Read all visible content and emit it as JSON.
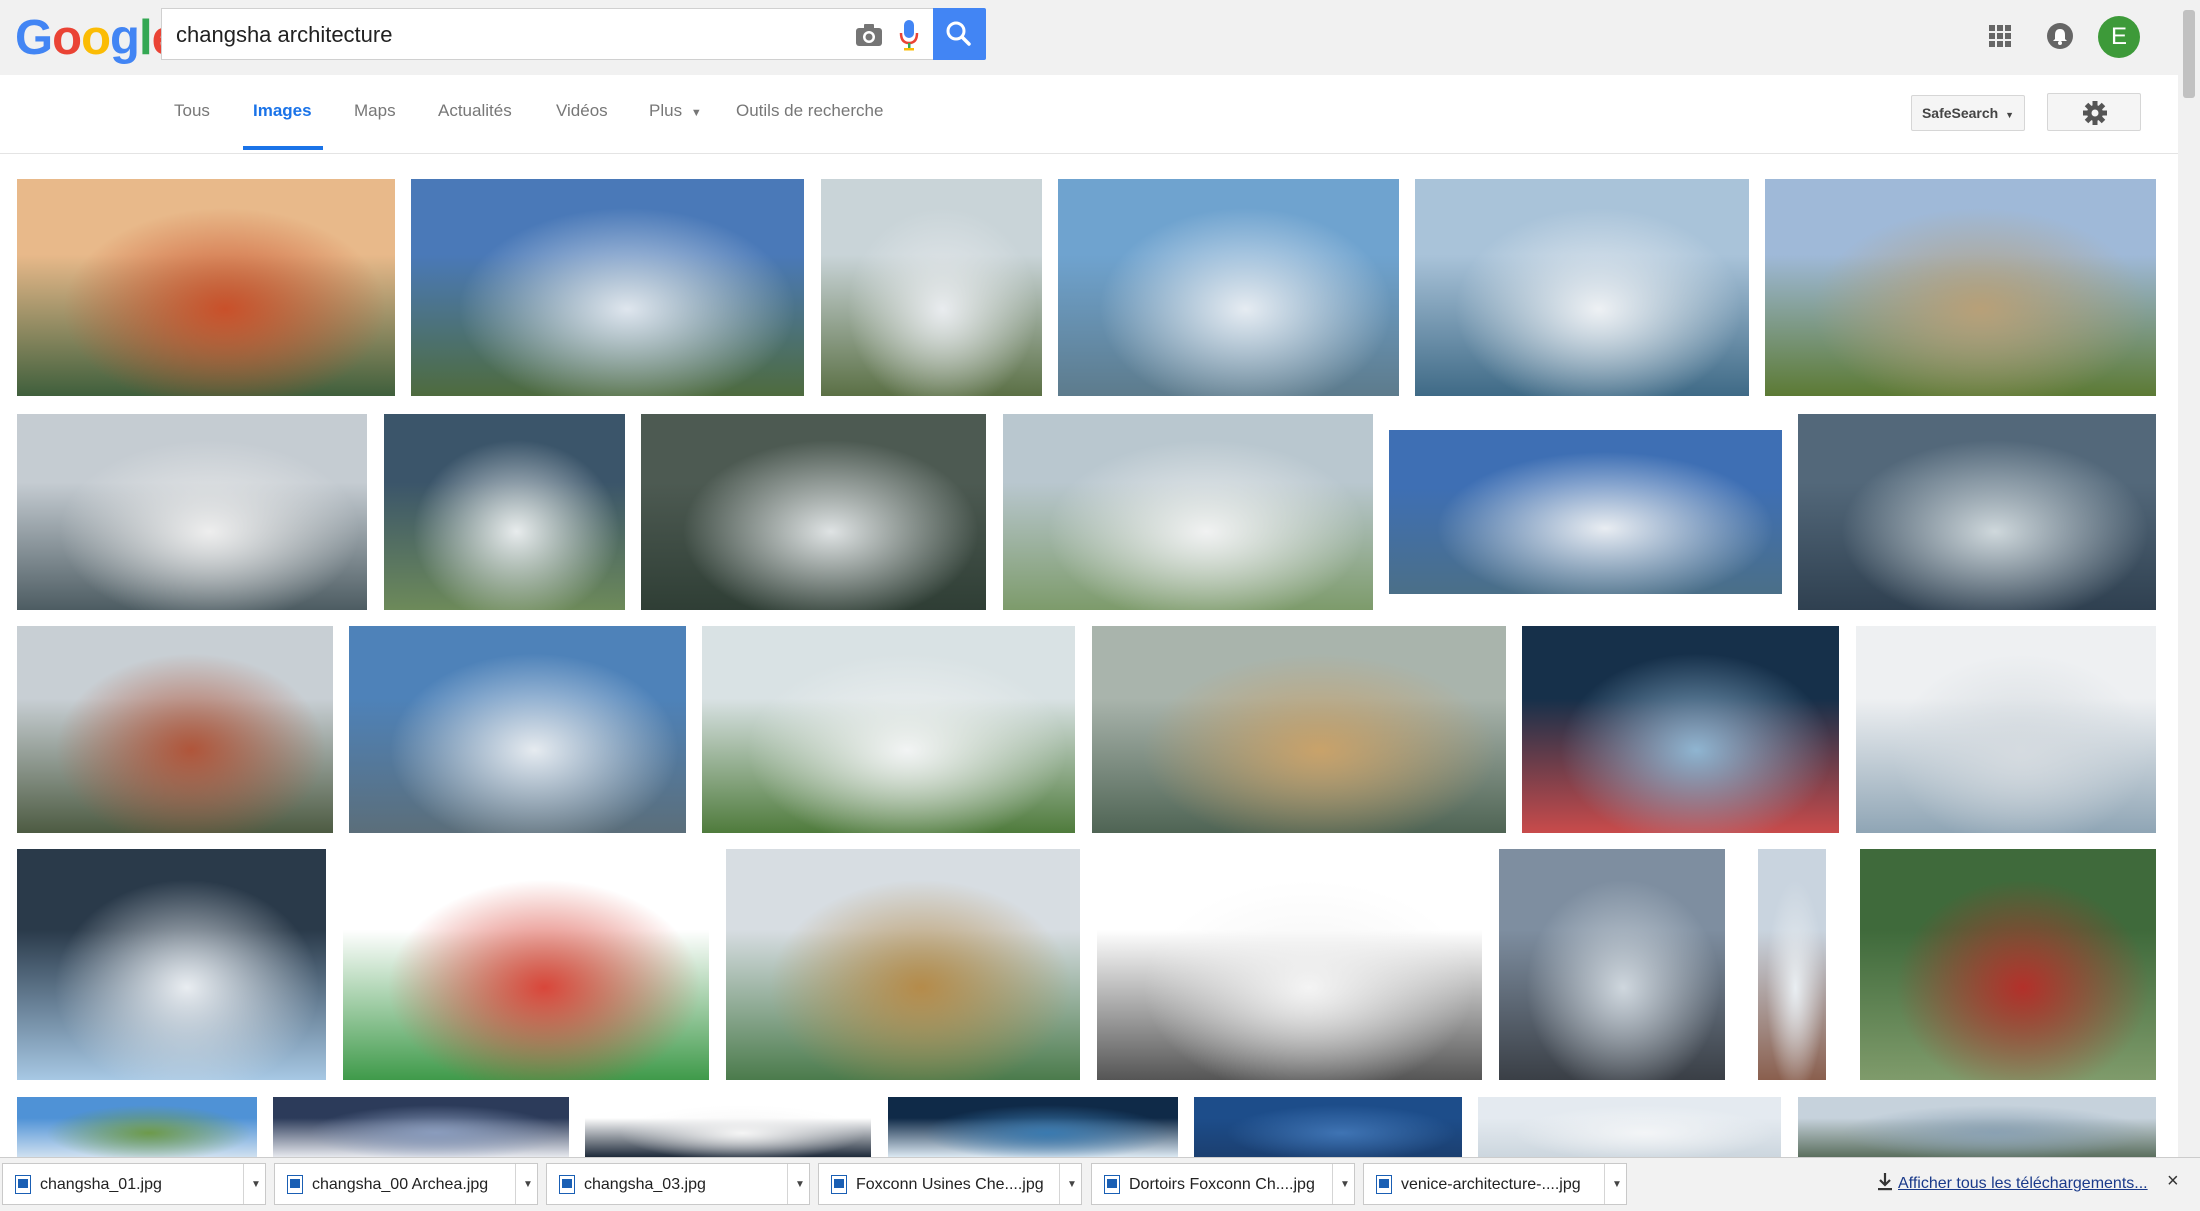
{
  "logo": {
    "text": "Google"
  },
  "search": {
    "value": "changsha architecture"
  },
  "avatar_letter": "E",
  "tabs": [
    {
      "label": "Tous"
    },
    {
      "label": "Images"
    },
    {
      "label": "Maps"
    },
    {
      "label": "Actualités"
    },
    {
      "label": "Vidéos"
    },
    {
      "label": "Plus"
    },
    {
      "label": "Outils de recherche"
    }
  ],
  "active_tab": "Images",
  "safesearch_label": "SafeSearch",
  "colors": {
    "accent": "#1a73e8",
    "search_button": "#4285f4",
    "avatar": "#3d9a39"
  },
  "images": [
    {
      "name": "orange-ribbon-bridge-render",
      "colors": [
        "#e8b98a",
        "#c9502a",
        "#3f5f3c"
      ]
    },
    {
      "name": "white-curved-building-landscape",
      "colors": [
        "#4a79b8",
        "#dfe6ee",
        "#4e6b3e"
      ]
    },
    {
      "name": "flower-shaped-complex-aerial",
      "colors": [
        "#c9d4d8",
        "#e9ecef",
        "#5b7045"
      ]
    },
    {
      "name": "waterfront-opera-house-render",
      "colors": [
        "#6fa3cf",
        "#e6ecf2",
        "#5d7b8c"
      ]
    },
    {
      "name": "city-riverside-complex-aerial",
      "colors": [
        "#a9c3d9",
        "#eef1f4",
        "#3f6a86"
      ]
    },
    {
      "name": "couple-beside-stone-statue",
      "colors": [
        "#9fb9d8",
        "#b8a078",
        "#5c7a34"
      ]
    },
    {
      "name": "complex-with-reflecting-pools",
      "colors": [
        "#c5ccd2",
        "#eeeeee",
        "#4d5c62"
      ]
    },
    {
      "name": "flower-roof-plan-view",
      "colors": [
        "#3b556a",
        "#e8eced",
        "#6d8a5a"
      ]
    },
    {
      "name": "flower-complex-night-aerial",
      "colors": [
        "#4d5a52",
        "#dfe3e4",
        "#2f3e35"
      ]
    },
    {
      "name": "cultural-center-birdseye",
      "colors": [
        "#b9c7cf",
        "#f1f2f2",
        "#7d9b6b"
      ]
    },
    {
      "name": "waterfront-crowd-render",
      "colors": [
        "#3e6fb4",
        "#e9edf2",
        "#4b6f88"
      ]
    },
    {
      "name": "glass-atrium-interior",
      "colors": [
        "#53687a",
        "#cfd8dc",
        "#2f4050"
      ]
    },
    {
      "name": "tower-with-red-soil-site",
      "colors": [
        "#c8cfd4",
        "#b0553a",
        "#4d5b42"
      ]
    },
    {
      "name": "opera-house-dusk-render",
      "colors": [
        "#4e82b9",
        "#e6ebf0",
        "#5b6e7a"
      ]
    },
    {
      "name": "crystal-building-in-park",
      "colors": [
        "#d9e2e4",
        "#f2f4f4",
        "#4f7b3c"
      ]
    },
    {
      "name": "golden-roof-masterplan",
      "colors": [
        "#a9b4ac",
        "#c9a26a",
        "#4f6454"
      ]
    },
    {
      "name": "crystal-facade-night",
      "colors": [
        "#16304a",
        "#8fb5d1",
        "#c94b4b"
      ]
    },
    {
      "name": "curved-white-interior",
      "colors": [
        "#eef0f2",
        "#d5dbe0",
        "#8fa5b5"
      ]
    },
    {
      "name": "curved-hall-people",
      "colors": [
        "#2a3a4a",
        "#e9edf1",
        "#a7c8e4"
      ]
    },
    {
      "name": "ribbon-bridge-sketches",
      "colors": [
        "#ffffff",
        "#d9463a",
        "#3f9a4a"
      ]
    },
    {
      "name": "skyscraper-cluster-render",
      "colors": [
        "#d7dde2",
        "#b58b4a",
        "#4b7b4c"
      ]
    },
    {
      "name": "floor-plan-drawing",
      "colors": [
        "#ffffff",
        "#f4f4f4",
        "#555555"
      ]
    },
    {
      "name": "deconstructed-facade-dusk",
      "colors": [
        "#7e8ea0",
        "#cfd7de",
        "#3a3f46"
      ]
    },
    {
      "name": "small-aerial-collage",
      "colors": [
        "#c9d4df",
        "#e9eef2",
        "#8a5f4e"
      ]
    },
    {
      "name": "red-pavilion-in-trees",
      "colors": [
        "#3f6a3b",
        "#b3302a",
        "#7f9b6b"
      ]
    },
    {
      "name": "treeline-blue-sky",
      "colors": [
        "#4f92d6",
        "#6d9a4a",
        "#cfe0f0"
      ]
    },
    {
      "name": "dome-interior-dark",
      "colors": [
        "#2c3b5a",
        "#8a9cbd",
        "#e6e8ee"
      ]
    },
    {
      "name": "document-chart",
      "colors": [
        "#ffffff",
        "#f5f5f5",
        "#1e2a3a"
      ]
    },
    {
      "name": "night-city-lights",
      "colors": [
        "#0f2a48",
        "#3a7ab0",
        "#dbe8f2"
      ]
    },
    {
      "name": "deep-blue-sky",
      "colors": [
        "#1d4d8a",
        "#3f74b4",
        "#1b3f70"
      ]
    },
    {
      "name": "pale-winter-scene",
      "colors": [
        "#e4eaf0",
        "#f3f5f7",
        "#ccd6de"
      ]
    },
    {
      "name": "city-lake-aerial",
      "colors": [
        "#c6d2dc",
        "#8aa1b3",
        "#5b6f5e"
      ]
    }
  ],
  "downloads": [
    {
      "filename": "changsha_01.jpg"
    },
    {
      "filename": "changsha_00 Archea.jpg"
    },
    {
      "filename": "changsha_03.jpg"
    },
    {
      "filename": "Foxconn Usines Che....jpg"
    },
    {
      "filename": "Dortoirs Foxconn Ch....jpg"
    },
    {
      "filename": "venice-architecture-....jpg"
    }
  ],
  "show_all_downloads_label": "Afficher tous les téléchargements...",
  "close_label": "×"
}
